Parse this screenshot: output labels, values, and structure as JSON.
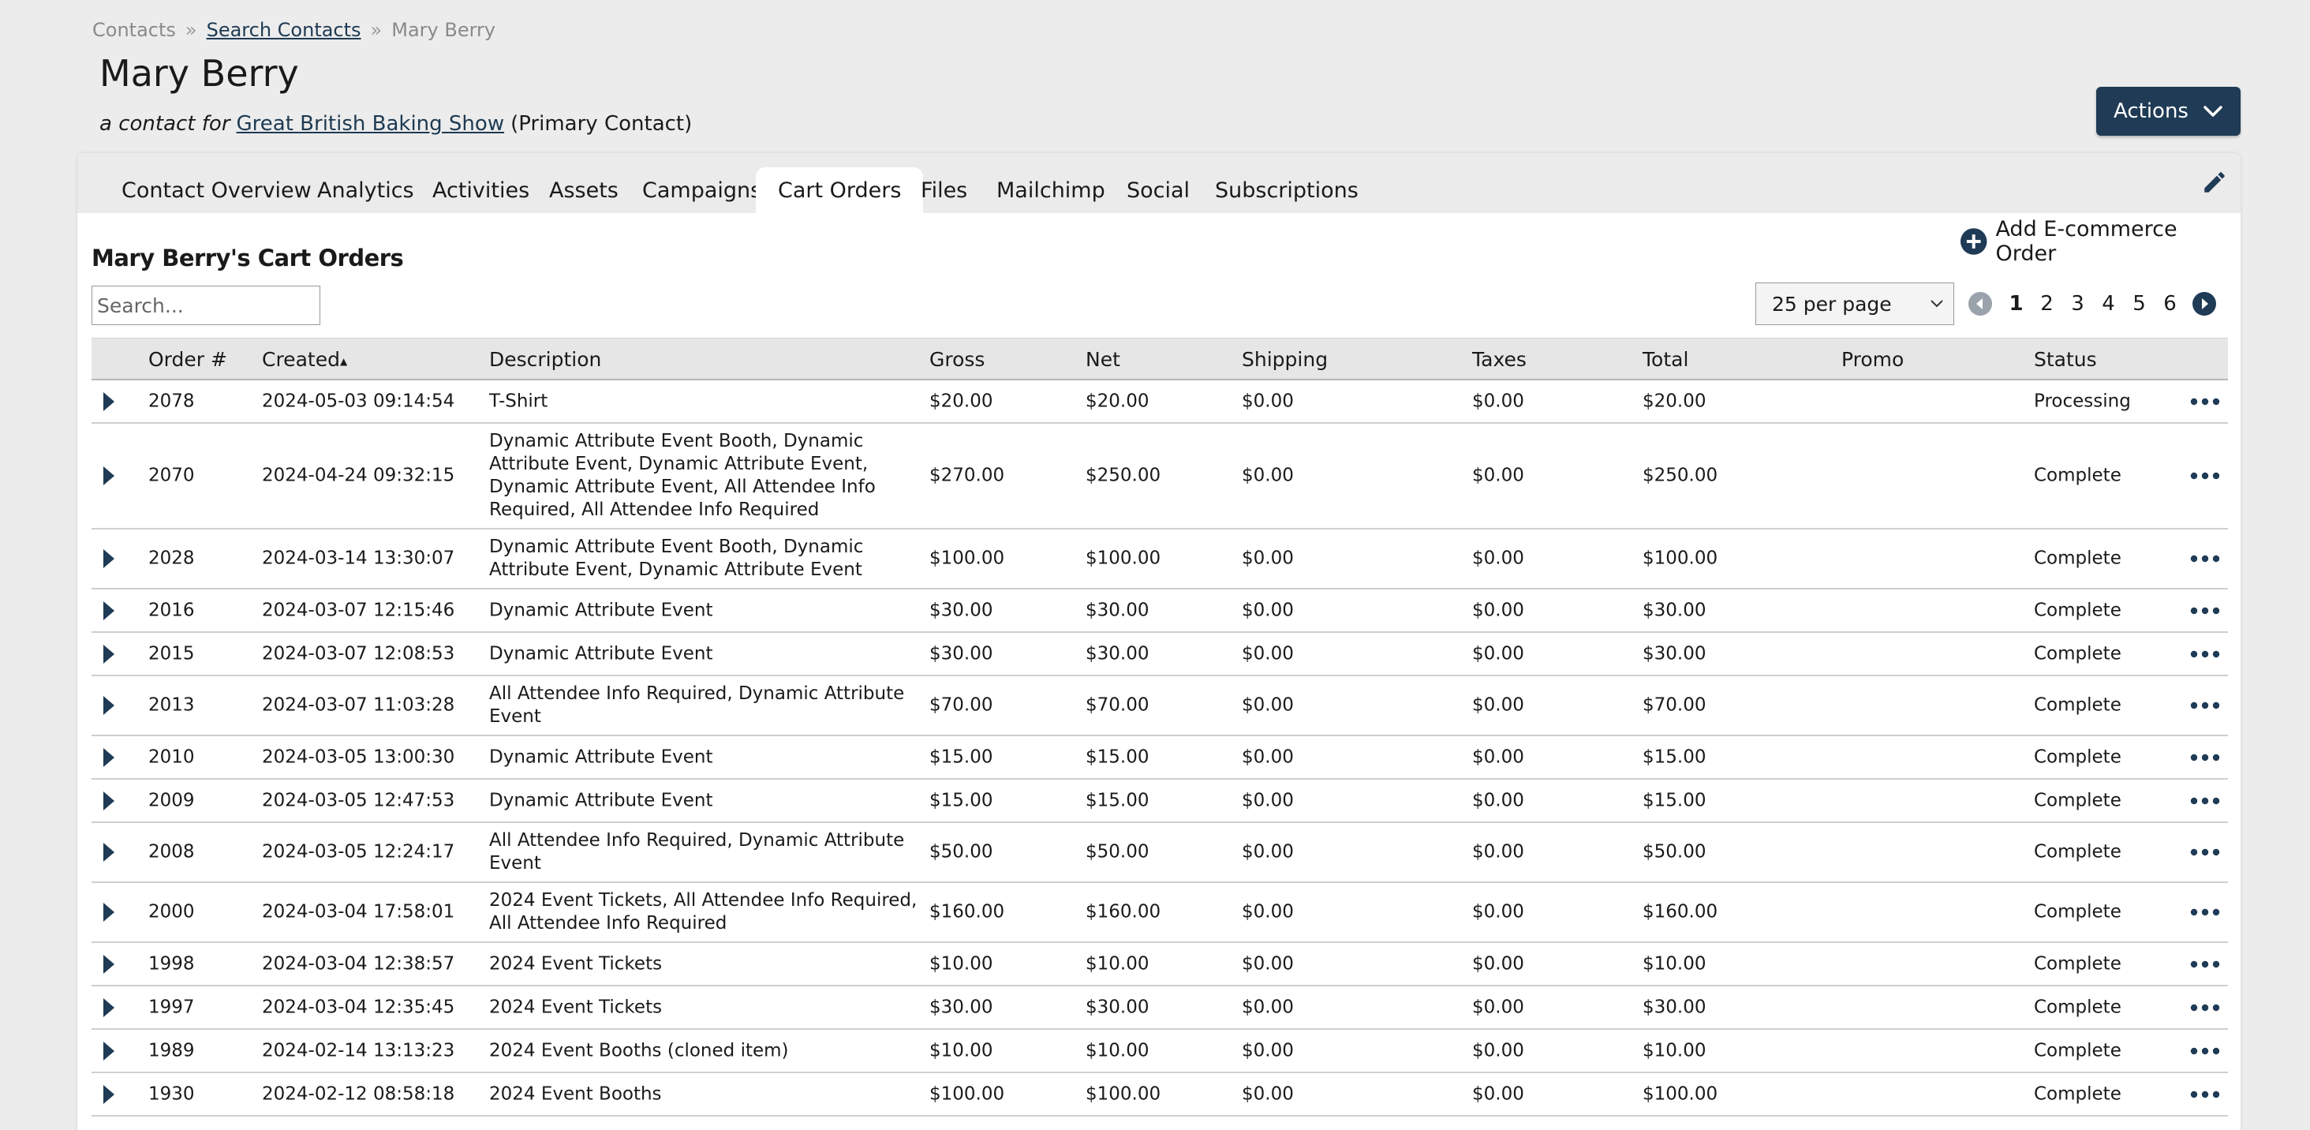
{
  "breadcrumb": {
    "root": "Contacts",
    "sep": "»",
    "search": "Search Contacts",
    "current": "Mary Berry"
  },
  "page_title": "Mary Berry",
  "subtitle": {
    "prefix": "a contact for",
    "org": "Great British Baking Show",
    "role": "(Primary Contact)"
  },
  "actions_label": "Actions",
  "tabs": [
    {
      "label": "Contact Overview"
    },
    {
      "label": "Analytics"
    },
    {
      "label": "Activities"
    },
    {
      "label": "Assets"
    },
    {
      "label": "Campaigns"
    },
    {
      "label": "Cart Orders"
    },
    {
      "label": "Files"
    },
    {
      "label": "Mailchimp"
    },
    {
      "label": "Social"
    },
    {
      "label": "Subscriptions"
    }
  ],
  "active_tab": "Cart Orders",
  "section_title": "Mary Berry's Cart Orders",
  "add_order_label": "Add E-commerce Order",
  "search": {
    "placeholder": "Search...",
    "value": ""
  },
  "per_page": "25 per page",
  "pages": [
    "1",
    "2",
    "3",
    "4",
    "5",
    "6"
  ],
  "current_page": "1",
  "table": {
    "columns": [
      "Order #",
      "Created",
      "Description",
      "Gross",
      "Net",
      "Shipping",
      "Taxes",
      "Total",
      "Promo",
      "Status"
    ],
    "sort_indicator": "▲",
    "rows": [
      {
        "order": "2078",
        "created": "2024-05-03 09:14:54",
        "description": "T-Shirt",
        "gross": "$20.00",
        "net": "$20.00",
        "shipping": "$0.00",
        "taxes": "$0.00",
        "total": "$20.00",
        "promo": "",
        "status": "Processing"
      },
      {
        "order": "2070",
        "created": "2024-04-24 09:32:15",
        "description": "Dynamic Attribute Event Booth, Dynamic Attribute Event, Dynamic Attribute Event, Dynamic Attribute Event, All Attendee Info Required, All Attendee Info Required",
        "gross": "$270.00",
        "net": "$250.00",
        "shipping": "$0.00",
        "taxes": "$0.00",
        "total": "$250.00",
        "promo": "",
        "status": "Complete"
      },
      {
        "order": "2028",
        "created": "2024-03-14 13:30:07",
        "description": "Dynamic Attribute Event Booth, Dynamic Attribute Event, Dynamic Attribute Event",
        "gross": "$100.00",
        "net": "$100.00",
        "shipping": "$0.00",
        "taxes": "$0.00",
        "total": "$100.00",
        "promo": "",
        "status": "Complete"
      },
      {
        "order": "2016",
        "created": "2024-03-07 12:15:46",
        "description": "Dynamic Attribute Event",
        "gross": "$30.00",
        "net": "$30.00",
        "shipping": "$0.00",
        "taxes": "$0.00",
        "total": "$30.00",
        "promo": "",
        "status": "Complete"
      },
      {
        "order": "2015",
        "created": "2024-03-07 12:08:53",
        "description": "Dynamic Attribute Event",
        "gross": "$30.00",
        "net": "$30.00",
        "shipping": "$0.00",
        "taxes": "$0.00",
        "total": "$30.00",
        "promo": "",
        "status": "Complete"
      },
      {
        "order": "2013",
        "created": "2024-03-07 11:03:28",
        "description": "All Attendee Info Required, Dynamic Attribute Event",
        "gross": "$70.00",
        "net": "$70.00",
        "shipping": "$0.00",
        "taxes": "$0.00",
        "total": "$70.00",
        "promo": "",
        "status": "Complete"
      },
      {
        "order": "2010",
        "created": "2024-03-05 13:00:30",
        "description": "Dynamic Attribute Event",
        "gross": "$15.00",
        "net": "$15.00",
        "shipping": "$0.00",
        "taxes": "$0.00",
        "total": "$15.00",
        "promo": "",
        "status": "Complete"
      },
      {
        "order": "2009",
        "created": "2024-03-05 12:47:53",
        "description": "Dynamic Attribute Event",
        "gross": "$15.00",
        "net": "$15.00",
        "shipping": "$0.00",
        "taxes": "$0.00",
        "total": "$15.00",
        "promo": "",
        "status": "Complete"
      },
      {
        "order": "2008",
        "created": "2024-03-05 12:24:17",
        "description": "All Attendee Info Required, Dynamic Attribute Event",
        "gross": "$50.00",
        "net": "$50.00",
        "shipping": "$0.00",
        "taxes": "$0.00",
        "total": "$50.00",
        "promo": "",
        "status": "Complete"
      },
      {
        "order": "2000",
        "created": "2024-03-04 17:58:01",
        "description": "2024 Event Tickets, All Attendee Info Required, All Attendee Info Required",
        "gross": "$160.00",
        "net": "$160.00",
        "shipping": "$0.00",
        "taxes": "$0.00",
        "total": "$160.00",
        "promo": "",
        "status": "Complete"
      },
      {
        "order": "1998",
        "created": "2024-03-04 12:38:57",
        "description": "2024 Event Tickets",
        "gross": "$10.00",
        "net": "$10.00",
        "shipping": "$0.00",
        "taxes": "$0.00",
        "total": "$10.00",
        "promo": "",
        "status": "Complete"
      },
      {
        "order": "1997",
        "created": "2024-03-04 12:35:45",
        "description": "2024 Event Tickets",
        "gross": "$30.00",
        "net": "$30.00",
        "shipping": "$0.00",
        "taxes": "$0.00",
        "total": "$30.00",
        "promo": "",
        "status": "Complete"
      },
      {
        "order": "1989",
        "created": "2024-02-14 13:13:23",
        "description": "2024 Event Booths (cloned item)",
        "gross": "$10.00",
        "net": "$10.00",
        "shipping": "$0.00",
        "taxes": "$0.00",
        "total": "$10.00",
        "promo": "",
        "status": "Complete"
      },
      {
        "order": "1930",
        "created": "2024-02-12 08:58:18",
        "description": "2024 Event Booths",
        "gross": "$100.00",
        "net": "$100.00",
        "shipping": "$0.00",
        "taxes": "$0.00",
        "total": "$100.00",
        "promo": "",
        "status": "Complete"
      }
    ]
  },
  "colors": {
    "brand_dark": "#1f3b55",
    "tab_bar": "#ebebeb",
    "table_header": "#e6e6e6"
  }
}
